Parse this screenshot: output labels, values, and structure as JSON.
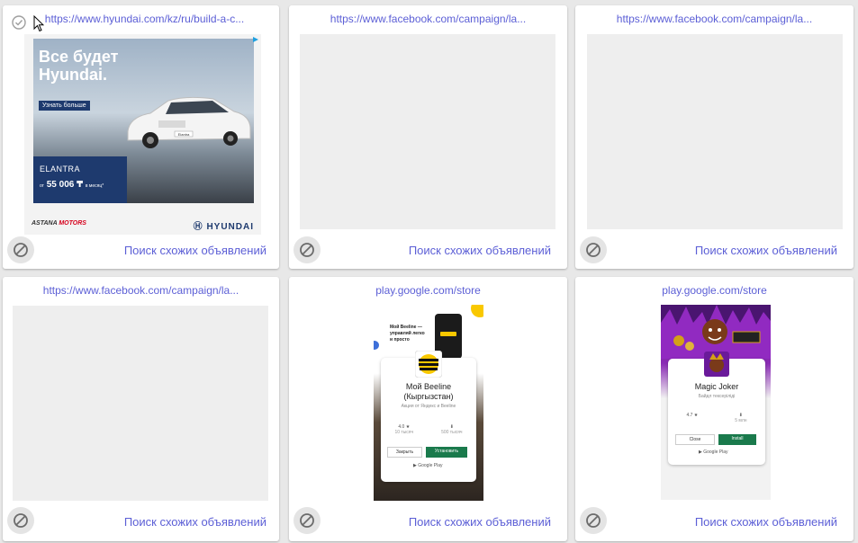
{
  "cards": [
    {
      "url": "https://www.hyundai.com/kz/ru/build-a-c...",
      "similar_label": "Поиск схожих объявлений",
      "ad": {
        "headline_line1": "Все будет",
        "headline_line2": "Hyundai.",
        "more_label": "Узнать больше",
        "model": "ELANTRA",
        "price_prefix": "от",
        "price": "55 006 ₸",
        "price_suffix": "в месяц*",
        "dealer_prefix": "ASTANA",
        "dealer_suffix": "MOTORS",
        "brand": "HYUNDAI",
        "car_badge": "Elantra"
      }
    },
    {
      "url": "https://www.facebook.com/campaign/la...",
      "similar_label": "Поиск схожих объявлений"
    },
    {
      "url": "https://www.facebook.com/campaign/la...",
      "similar_label": "Поиск схожих объявлений"
    },
    {
      "url": "https://www.facebook.com/campaign/la...",
      "similar_label": "Поиск схожих объявлений"
    },
    {
      "url": "play.google.com/store",
      "similar_label": "Поиск схожих объявлений",
      "app": {
        "promo_text": "Мой Beeline — управляй легко и просто",
        "name_line1": "Мой Beeline",
        "name_line2": "(Кыргызстан)",
        "developer": "Акция от Яндекс и Beeline",
        "rating": "4.0 ★",
        "rating_sub": "10 тысяч",
        "downloads": "⬇",
        "downloads_sub": "500 тысяч",
        "close_label": "Закрыть",
        "install_label": "Установить",
        "store_label": "Google Play"
      }
    },
    {
      "url": "play.google.com/store",
      "similar_label": "Поиск схожих объявлений",
      "app": {
        "name": "Magic Joker",
        "developer": "Байдл тексеріліді",
        "rating": "4.7 ★",
        "downloads": "⬇",
        "downloads_sub": "5 млн",
        "close_label": "Close",
        "install_label": "Install",
        "store_label": "Google Play"
      }
    }
  ],
  "icons": {
    "block": "block-icon",
    "check": "check-circle-icon",
    "cursor": "cursor-icon"
  },
  "colors": {
    "link": "#5c5fd6",
    "beeline_yellow": "#f9c800",
    "hyundai_blue": "#1e3a6e",
    "install_green": "#1a7a4c"
  }
}
